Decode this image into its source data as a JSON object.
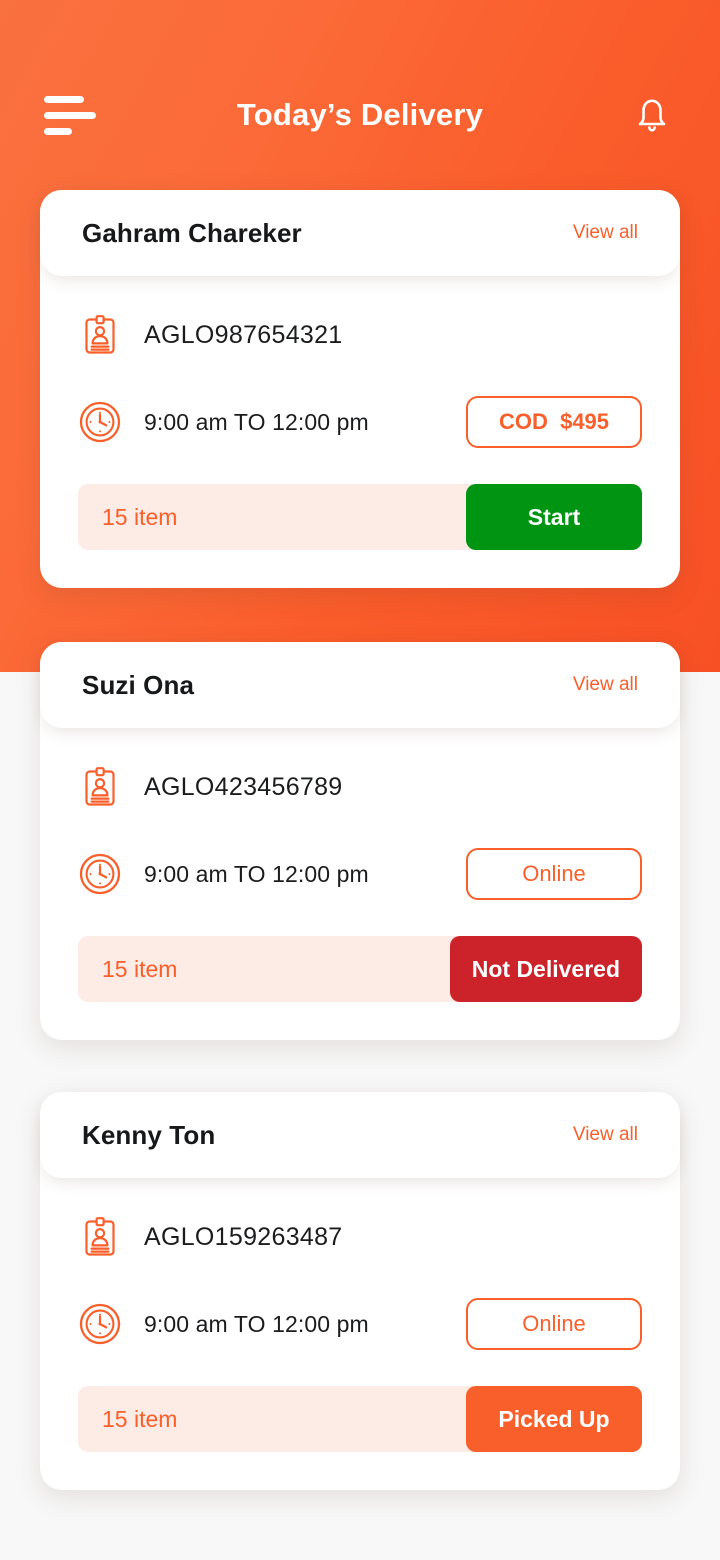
{
  "topbar": {
    "title": "Today’s Delivery",
    "menu_icon": "hamburger-menu-icon",
    "bell_icon": "notification-bell-icon"
  },
  "colors": {
    "brand_orange": "#f85f2b",
    "hero_gradient_start": "#f9713f",
    "hero_gradient_end": "#f75025",
    "start_green": "#009413",
    "not_delivered_red": "#cc2229",
    "footer_pink": "#fdebe6",
    "card_white": "#ffffff",
    "text_dark": "#17181a"
  },
  "labels": {
    "view_all": "View all",
    "order_icon": "id-badge-icon",
    "time_icon": "clock-icon"
  },
  "cards": [
    {
      "name": "Gahram Chareker",
      "view_all": "View all",
      "order_number": "AGLO987654321",
      "time_window": "9:00 am TO 12:00 pm",
      "payment": "COD  $495",
      "payment_type": "cod",
      "item_count": "15 item",
      "action": "Start",
      "action_style": "start"
    },
    {
      "name": "Suzi Ona",
      "view_all": "View all",
      "order_number": "AGLO423456789",
      "time_window": "9:00 am TO 12:00 pm",
      "payment": "Online",
      "payment_type": "online",
      "item_count": "15 item",
      "action": "Not Delivered",
      "action_style": "notdel"
    },
    {
      "name": "Kenny Ton",
      "view_all": "View all",
      "order_number": "AGLO159263487",
      "time_window": "9:00 am TO 12:00 pm",
      "payment": "Online",
      "payment_type": "online",
      "item_count": "15 item",
      "action": "Picked Up",
      "action_style": "picked"
    }
  ]
}
